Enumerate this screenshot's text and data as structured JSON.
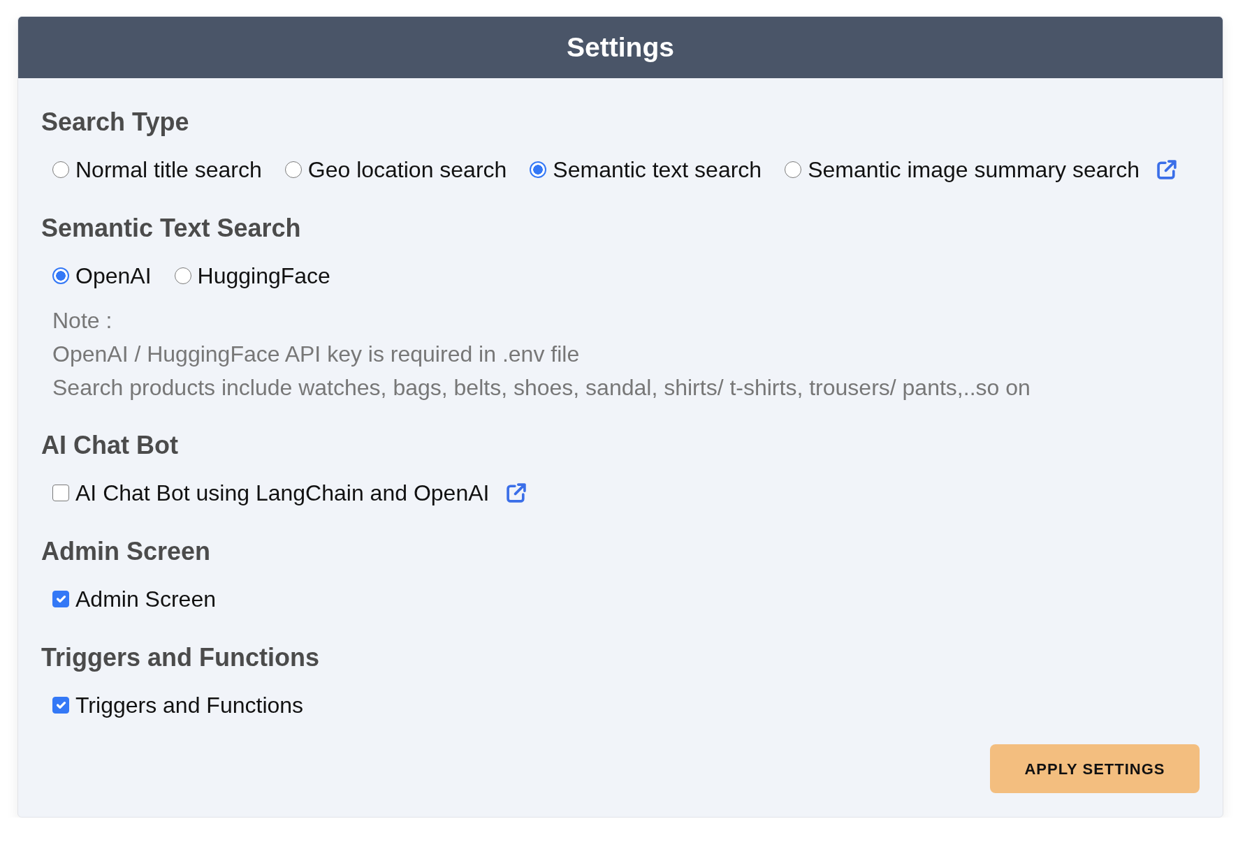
{
  "header": {
    "title": "Settings"
  },
  "sections": [
    {
      "heading": "Search Type",
      "kind": "radio",
      "options": [
        {
          "label": "Normal title search",
          "selected": false
        },
        {
          "label": "Geo location search",
          "selected": false
        },
        {
          "label": "Semantic text search",
          "selected": true
        },
        {
          "label": "Semantic image summary search",
          "selected": false
        }
      ],
      "external_link": true
    },
    {
      "heading": "Semantic Text Search",
      "kind": "radio",
      "options": [
        {
          "label": "OpenAI",
          "selected": true
        },
        {
          "label": "HuggingFace",
          "selected": false
        }
      ],
      "note": [
        "Note :",
        "OpenAI / HuggingFace API key is required in .env file",
        "Search products include watches, bags, belts, shoes, sandal, shirts/ t-shirts, trousers/ pants,..so on"
      ]
    },
    {
      "heading": "AI Chat Bot",
      "kind": "checkbox",
      "options": [
        {
          "label": "AI Chat Bot using LangChain and OpenAI",
          "checked": false
        }
      ],
      "external_link": true
    },
    {
      "heading": "Admin Screen",
      "kind": "checkbox",
      "options": [
        {
          "label": "Admin Screen",
          "checked": true
        }
      ]
    },
    {
      "heading": "Triggers and Functions",
      "kind": "checkbox",
      "options": [
        {
          "label": "Triggers and Functions",
          "checked": true
        }
      ]
    }
  ],
  "apply_button": {
    "label": "APPLY SETTINGS"
  }
}
